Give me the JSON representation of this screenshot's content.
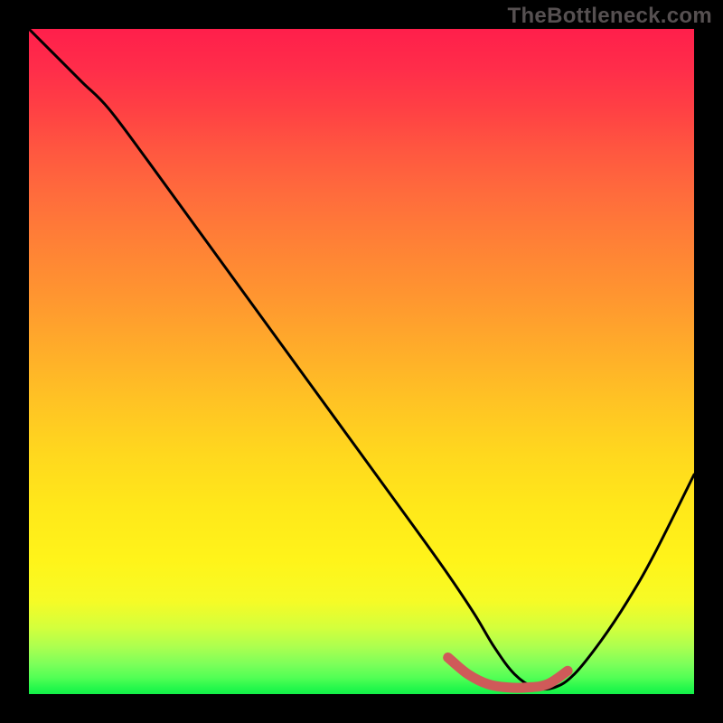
{
  "watermark": "TheBottleneck.com",
  "chart_data": {
    "type": "line",
    "title": "",
    "xlabel": "",
    "ylabel": "",
    "xlim": [
      0,
      100
    ],
    "ylim": [
      0,
      100
    ],
    "grid": false,
    "legend": false,
    "series": [
      {
        "name": "curve",
        "color": "#000000",
        "x": [
          0,
          4,
          8,
          12,
          18,
          26,
          34,
          42,
          50,
          58,
          63,
          67,
          70,
          73,
          76,
          79,
          82,
          86,
          90,
          94,
          100
        ],
        "y": [
          100,
          96,
          92,
          88,
          80,
          69,
          58,
          47,
          36,
          25,
          18,
          12,
          7,
          3,
          1,
          1,
          3,
          8,
          14,
          21,
          33
        ]
      },
      {
        "name": "highlight",
        "color": "#cf5a59",
        "x": [
          63,
          66,
          69,
          72,
          75,
          78,
          81
        ],
        "y": [
          5.5,
          3.0,
          1.5,
          1.0,
          1.0,
          1.5,
          3.5
        ]
      }
    ],
    "colors": {
      "background_top": "#ff1f4b",
      "background_bottom": "#12f048",
      "page_background": "#000000",
      "watermark": "#565051"
    }
  }
}
